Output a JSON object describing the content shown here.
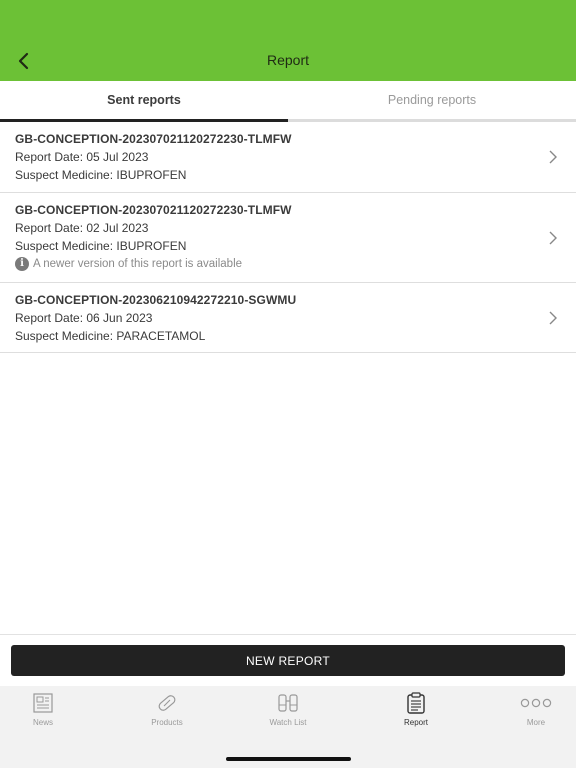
{
  "header": {
    "title": "Report"
  },
  "tabs": [
    {
      "label": "Sent reports",
      "active": true
    },
    {
      "label": "Pending reports",
      "active": false
    }
  ],
  "reports": [
    {
      "id": "GB-CONCEPTION-202307021120272230-TLMFW",
      "date": "Report Date: 05 Jul 2023",
      "medicine": "Suspect Medicine: IBUPROFEN",
      "note": ""
    },
    {
      "id": "GB-CONCEPTION-202307021120272230-TLMFW",
      "date": "Report Date: 02 Jul 2023",
      "medicine": "Suspect Medicine: IBUPROFEN",
      "note": "A newer version of this report is available"
    },
    {
      "id": "GB-CONCEPTION-202306210942272210-SGWMU",
      "date": "Report Date: 06 Jun 2023",
      "medicine": "Suspect Medicine: PARACETAMOL",
      "note": ""
    }
  ],
  "new_report_label": "NEW REPORT",
  "tabbar": [
    {
      "label": "News",
      "icon": "news-icon",
      "active": false
    },
    {
      "label": "Products",
      "icon": "pill-icon",
      "active": false
    },
    {
      "label": "Watch List",
      "icon": "binoculars-icon",
      "active": false
    },
    {
      "label": "Report",
      "icon": "clipboard-icon",
      "active": true
    },
    {
      "label": "More",
      "icon": "more-dots-icon",
      "active": false
    }
  ],
  "colors": {
    "header": "#6cc136",
    "button": "#222222",
    "tabbar": "#f2f2f2"
  }
}
